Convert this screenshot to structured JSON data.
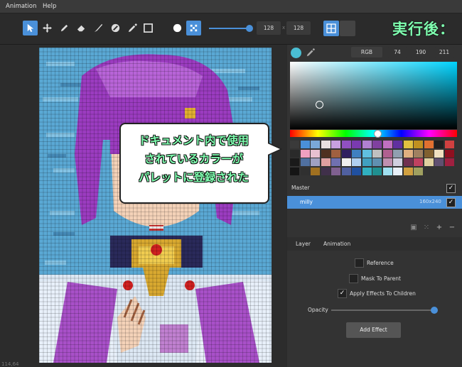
{
  "menu": {
    "items": [
      "Animation",
      "Help"
    ]
  },
  "toolbar": {
    "width_value": "128",
    "height_value": "128",
    "separator": "x"
  },
  "overlay": {
    "title": "実行後：",
    "bubble_lines": [
      "ドキュメント内で使用",
      "されているカラーが",
      "パレットに登録された"
    ]
  },
  "canvas": {
    "coordinates": "114,64"
  },
  "color": {
    "mode_label": "RGB",
    "r": "74",
    "g": "190",
    "b": "211",
    "current_hex": "#4abed3"
  },
  "palette_colors": [
    "#3a3a3a",
    "#4a90d9",
    "#7aa8d8",
    "#e8e0e0",
    "#c8a0e0",
    "#9050c0",
    "#7a3ab0",
    "#b080d0",
    "#8040a0",
    "#c070c0",
    "#6030a0",
    "#e0c040",
    "#c09020",
    "#e07030",
    "#202020",
    "#d04040",
    "#2a2a2a",
    "#f0a0c0",
    "#e8c0d0",
    "#503020",
    "#a06040",
    "#302060",
    "#4080c0",
    "#60c0e0",
    "#c0c0c0",
    "#b06090",
    "#90a0b0",
    "#e0b080",
    "#a08060",
    "#806030",
    "#f0e0c0",
    "#901020",
    "#1a1a1a",
    "#5070a0",
    "#a0a0c0",
    "#e0a0a0",
    "#7070b0",
    "#f0f0f0",
    "#b0d0f0",
    "#40a0c0",
    "#6090b0",
    "#c090b0",
    "#d0d0e0",
    "#703050",
    "#c04060",
    "#e0d0a0",
    "#605070",
    "#a02040",
    "#151515",
    "#303030",
    "#a07020",
    "#40304a",
    "#806090",
    "#5060a0",
    "#2050a0",
    "#30b0c0",
    "#209090",
    "#a0e0f0",
    "#e8f0f8",
    "#d0a040",
    "#a0a060"
  ],
  "layers": {
    "header": "Master",
    "items": [
      {
        "name": "milly",
        "size": "160x240"
      }
    ]
  },
  "tabs": [
    "Layer",
    "Animation"
  ],
  "properties": {
    "reference": "Reference",
    "mask": "Mask To Parent",
    "apply_effects": "Apply Effects To Children",
    "opacity_label": "Opacity",
    "opacity_value": 1.0,
    "add_effect": "Add Effect"
  }
}
